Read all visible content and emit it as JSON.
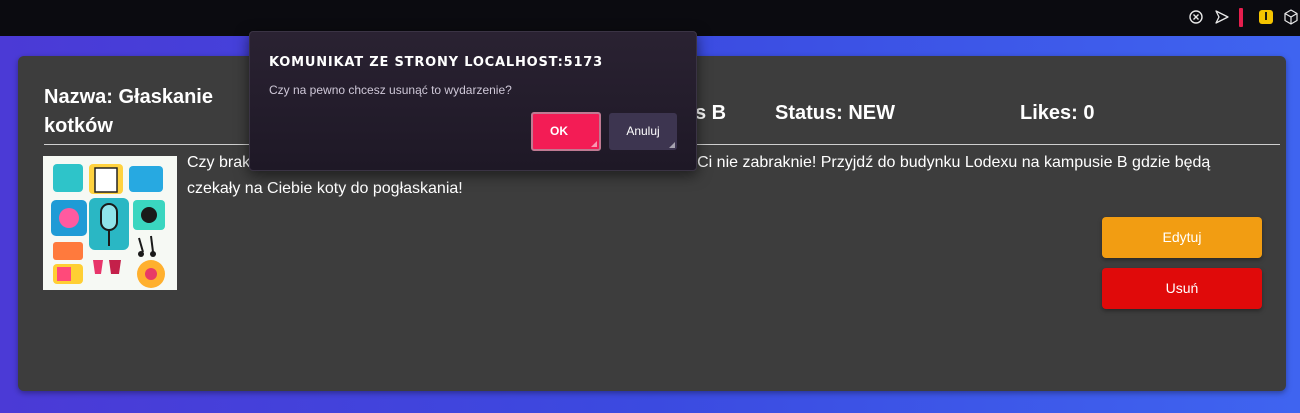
{
  "browser": {
    "icons": [
      "close-circle-icon",
      "send-icon",
      "bookmark-red-icon",
      "extension-l-icon",
      "cube-icon"
    ],
    "extension_letter": "l"
  },
  "event": {
    "name": "Nazwa: Głaskanie kotków",
    "location_partial": "s B",
    "status": "Status: NEW",
    "likes": "Likes: 0",
    "description_before": "Czy brak",
    "description_after": "Ci nie zabraknie! Przyjdź do budynku Lodexu na kampusie B gdzie będą czekały na Ciebie koty do pogłaskania!",
    "image": "event-collage-image"
  },
  "actions": {
    "edit_label": "Edytuj",
    "delete_label": "Usuń"
  },
  "dialog": {
    "title": "KOMUNIKAT ZE STRONY LOCALHOST:5173",
    "message": "Czy na pewno chcesz usunąć to wydarzenie?",
    "ok_label": "OK",
    "cancel_label": "Anuluj"
  },
  "colors": {
    "accent_ok": "#f31c55",
    "edit": "#f29d12",
    "delete": "#e00a0a",
    "card": "#3d3d3d"
  }
}
